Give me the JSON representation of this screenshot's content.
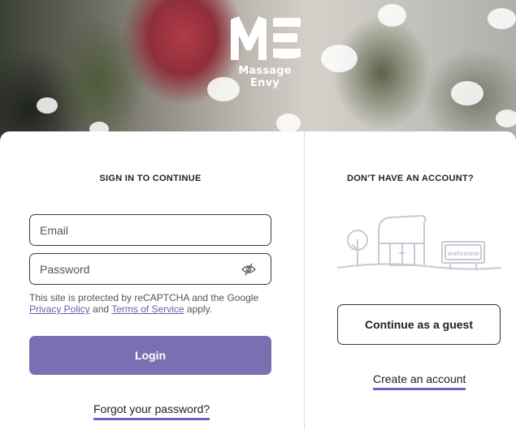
{
  "brand": {
    "logo_letters": "ME",
    "name": "Massage Envy"
  },
  "signin": {
    "heading": "SIGN IN TO CONTINUE",
    "email_placeholder": "Email",
    "password_placeholder": "Password",
    "recaptcha_prefix": "This site is protected by reCAPTCHA and the Google",
    "privacy_link": "Privacy Policy",
    "recaptcha_and": "and",
    "terms_link": "Terms of Service",
    "recaptcha_suffix": "apply.",
    "login_label": "Login",
    "forgot_label": "Forgot your password?"
  },
  "guest": {
    "heading": "DON'T HAVE AN ACCOUNT?",
    "sign_text": "welcome",
    "continue_label": "Continue as a guest",
    "create_label": "Create an account"
  },
  "colors": {
    "accent": "#7a6fb0",
    "underline": "#7c5bd6",
    "border": "#3b3b3b"
  },
  "icons": {
    "password_toggle": "eye-slash-icon",
    "illustration": "storefront-illustration"
  }
}
